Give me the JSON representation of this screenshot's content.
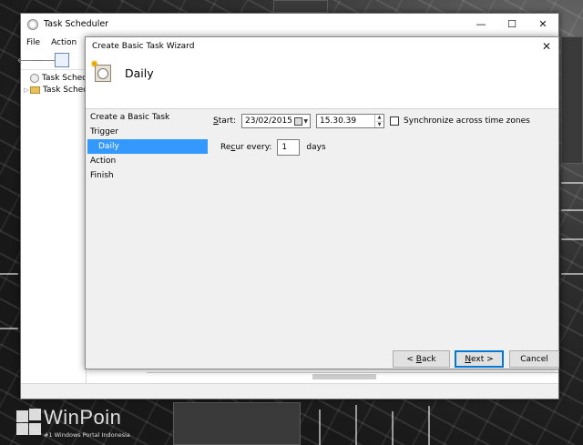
{
  "main_window": {
    "title": "Task Scheduler",
    "controls": {
      "minimize": "—",
      "maximize": "☐",
      "close": "✕"
    },
    "menu": [
      "File",
      "Action"
    ],
    "tree": [
      {
        "label": "Task Schedul",
        "icon": "clock-icon"
      },
      {
        "label": "Task Schedu",
        "icon": "folder-icon"
      }
    ]
  },
  "wizard": {
    "title": "Create Basic Task Wizard",
    "close": "✕",
    "heading": "Daily",
    "steps": [
      {
        "label": "Create a Basic Task",
        "selected": false,
        "sub": false
      },
      {
        "label": "Trigger",
        "selected": false,
        "sub": false
      },
      {
        "label": "Daily",
        "selected": true,
        "sub": true
      },
      {
        "label": "Action",
        "selected": false,
        "sub": false
      },
      {
        "label": "Finish",
        "selected": false,
        "sub": false
      }
    ],
    "start": {
      "label_accel": "S",
      "label_rest": "tart:",
      "date": "23/02/2015",
      "time": "15.30.39"
    },
    "sync": {
      "label": "Synchronize across time zones",
      "checked": false
    },
    "recur": {
      "label_pre": "Re",
      "label_accel": "c",
      "label_post": "ur every:",
      "value": "1",
      "unit": "days"
    },
    "buttons": {
      "back_pre": "< ",
      "back_accel": "B",
      "back_post": "ack",
      "next_accel": "N",
      "next_post": "ext >",
      "cancel": "Cancel"
    }
  },
  "watermark": {
    "name": "WinPoin",
    "tagline": "#1 Windows Portal Indonesia"
  },
  "colors": {
    "selection": "#3399ff",
    "default_button_border": "#0078d7"
  }
}
